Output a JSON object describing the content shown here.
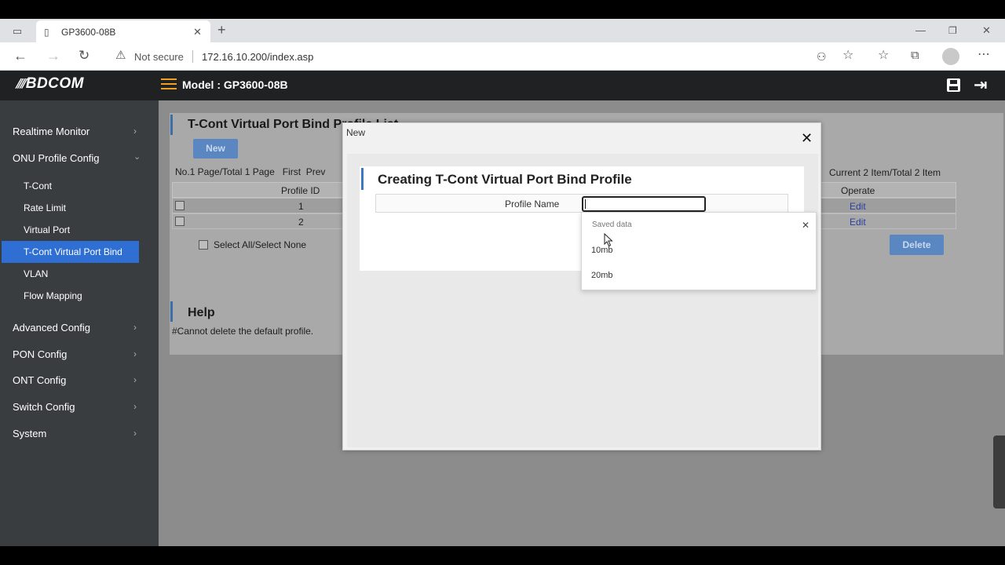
{
  "browser": {
    "tab_title": "GP3600-08B",
    "security_label": "Not secure",
    "url": "172.16.10.200/index.asp"
  },
  "header": {
    "logo_text": "BDCOM",
    "model_text": "Model : GP3600-08B"
  },
  "sidebar": {
    "items": [
      {
        "label": "Realtime Monitor"
      },
      {
        "label": "ONU Profile Config"
      },
      {
        "label": "Advanced Config"
      },
      {
        "label": "PON Config"
      },
      {
        "label": "ONT Config"
      },
      {
        "label": "Switch Config"
      },
      {
        "label": "System"
      }
    ],
    "subitems": [
      {
        "label": "T-Cont"
      },
      {
        "label": "Rate Limit"
      },
      {
        "label": "Virtual Port"
      },
      {
        "label": "T-Cont Virtual Port Bind"
      },
      {
        "label": "VLAN"
      },
      {
        "label": "Flow Mapping"
      }
    ],
    "active_subitem": "T-Cont Virtual Port Bind"
  },
  "main": {
    "section_title": "T-Cont Virtual Port Bind Profile List",
    "new_button": "New",
    "pagination_left": "No.1 Page/Total 1 Page   First  Prev",
    "pagination_right": "Current 2 Item/Total 2 Item",
    "columns": {
      "profile_id": "Profile ID",
      "operate": "Operate"
    },
    "rows": [
      {
        "id": "1",
        "action": "Edit"
      },
      {
        "id": "2",
        "action": "Edit"
      }
    ],
    "select_all_label": "Select All/Select None",
    "delete_button": "Delete",
    "help_title": "Help",
    "help_text": "#Cannot delete the default profile."
  },
  "modal": {
    "window_title": "New",
    "close_glyph": "✕",
    "heading": "Creating T-Cont Virtual Port Bind Profile",
    "field_label": "Profile Name",
    "field_value": ""
  },
  "autofill": {
    "header": "Saved data",
    "options": [
      "10mb",
      "20mb"
    ],
    "close_glyph": "✕"
  },
  "colors": {
    "accent": "#2f6fd3",
    "sidebar_bg": "#3a3d40",
    "header_bg": "#1f2123"
  }
}
